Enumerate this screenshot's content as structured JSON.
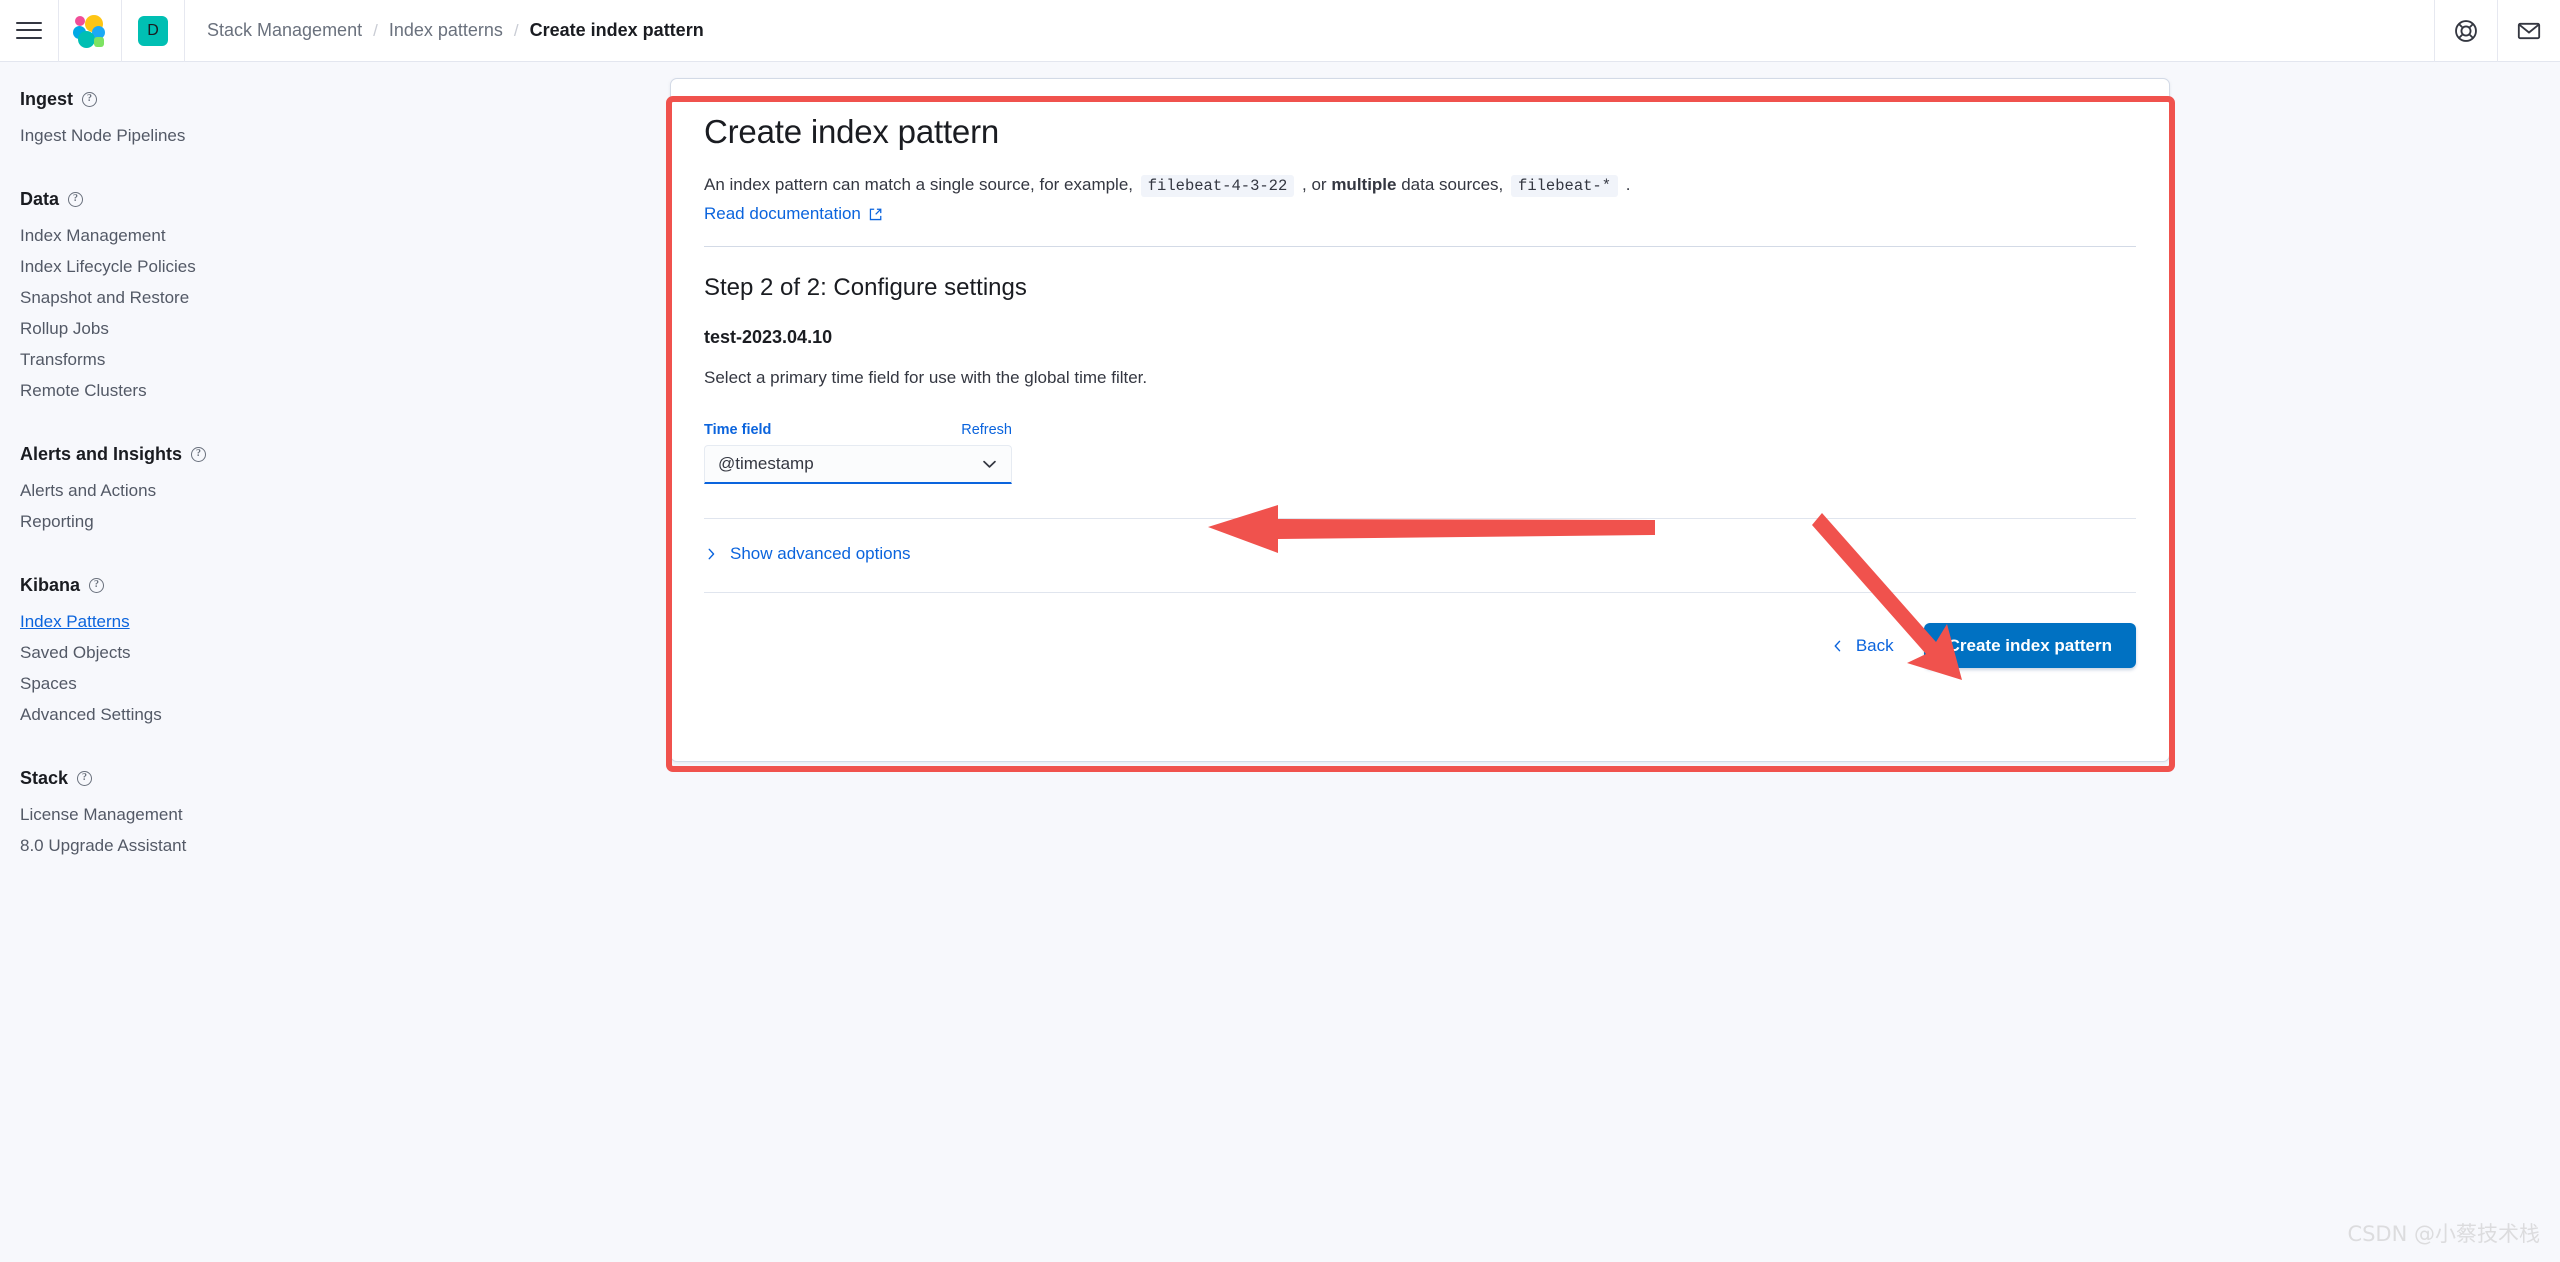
{
  "header": {
    "menu_icon": "hamburger-menu-icon",
    "logo_icon": "elastic-logo-icon",
    "space_avatar": "D",
    "breadcrumbs": [
      {
        "label": "Stack Management",
        "active": false
      },
      {
        "label": "Index patterns",
        "active": false
      },
      {
        "label": "Create index pattern",
        "active": true
      }
    ],
    "separator": "/",
    "right_icons": [
      {
        "name": "help-life-ring-icon"
      },
      {
        "name": "news-mail-icon"
      }
    ]
  },
  "sidebar": {
    "groups": [
      {
        "title": "Ingest",
        "help_icon": "question-circle-icon",
        "items": [
          {
            "label": "Ingest Node Pipelines",
            "active": false
          }
        ]
      },
      {
        "title": "Data",
        "help_icon": "question-circle-icon",
        "items": [
          {
            "label": "Index Management",
            "active": false
          },
          {
            "label": "Index Lifecycle Policies",
            "active": false
          },
          {
            "label": "Snapshot and Restore",
            "active": false
          },
          {
            "label": "Rollup Jobs",
            "active": false
          },
          {
            "label": "Transforms",
            "active": false
          },
          {
            "label": "Remote Clusters",
            "active": false
          }
        ]
      },
      {
        "title": "Alerts and Insights",
        "help_icon": "question-circle-icon",
        "items": [
          {
            "label": "Alerts and Actions",
            "active": false
          },
          {
            "label": "Reporting",
            "active": false
          }
        ]
      },
      {
        "title": "Kibana",
        "help_icon": "question-circle-icon",
        "items": [
          {
            "label": "Index Patterns",
            "active": true
          },
          {
            "label": "Saved Objects",
            "active": false
          },
          {
            "label": "Spaces",
            "active": false
          },
          {
            "label": "Advanced Settings",
            "active": false
          }
        ]
      },
      {
        "title": "Stack",
        "help_icon": "question-circle-icon",
        "items": [
          {
            "label": "License Management",
            "active": false
          },
          {
            "label": "8.0 Upgrade Assistant",
            "active": false
          }
        ]
      }
    ]
  },
  "panel": {
    "title": "Create index pattern",
    "description": {
      "part1": "An index pattern can match a single source, for example,",
      "code1": "filebeat-4-3-22",
      "part2": ", or",
      "bold": "multiple",
      "part3": "data sources,",
      "code2": "filebeat-*",
      "part4": "."
    },
    "doc_link": "Read documentation",
    "doc_link_icon": "external-link-icon",
    "step_title": "Step 2 of 2: Configure settings",
    "index_name": "test-2023.04.10",
    "select_description": "Select a primary time field for use with the global time filter.",
    "time_field": {
      "label": "Time field",
      "refresh_label": "Refresh",
      "value": "@timestamp",
      "caret_icon": "chevron-down-icon"
    },
    "advanced": {
      "label": "Show advanced options",
      "icon": "chevron-right-icon"
    },
    "footer": {
      "back_label": "Back",
      "back_icon": "chevron-left-icon",
      "create_label": "Create index pattern"
    }
  },
  "annotations": {
    "highlight_color": "#f0524d",
    "arrows": [
      {
        "name": "arrow-to-time-field",
        "direction": "left"
      },
      {
        "name": "arrow-to-create-button",
        "direction": "down-right"
      }
    ]
  },
  "watermark": "CSDN @小蔡技术栈",
  "colors": {
    "accent_blue": "#0b64dd",
    "primary_button": "#0071c2",
    "annotation_red": "#f0524d",
    "background": "#f7f8fc"
  }
}
